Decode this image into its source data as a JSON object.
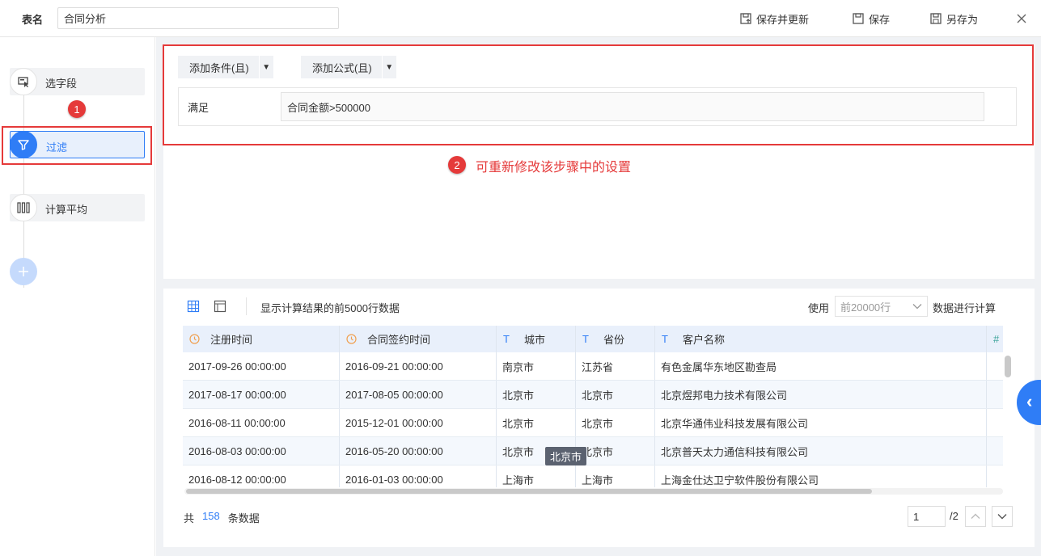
{
  "header": {
    "table_name_label": "表名",
    "table_name_value": "合同分析",
    "save_update_label": "保存并更新",
    "save_label": "保存",
    "save_as_label": "另存为"
  },
  "steps": [
    {
      "label": "选字段",
      "icon": "select-field-icon"
    },
    {
      "label": "过滤",
      "icon": "filter-icon"
    },
    {
      "label": "计算平均",
      "icon": "calc-average-icon"
    }
  ],
  "annotations": {
    "one": "1",
    "two": "2",
    "hint": "可重新修改该步骤中的设置",
    "color": "#e53a3a"
  },
  "filter": {
    "add_condition_label": "添加条件(且)",
    "add_formula_label": "添加公式(且)",
    "satisfy_label": "满足",
    "condition_value": "合同金额>500000"
  },
  "preview": {
    "info": "显示计算结果的前5000行数据",
    "use_label": "使用",
    "use_value": "前20000行",
    "use_suffix": "数据进行计算",
    "columns": [
      {
        "name": "注册时间",
        "type": "date"
      },
      {
        "name": "合同签约时间",
        "type": "date"
      },
      {
        "name": "城市",
        "type": "text"
      },
      {
        "name": "省份",
        "type": "text"
      },
      {
        "name": "客户名称",
        "type": "text"
      },
      {
        "name": "",
        "type": "number"
      }
    ],
    "rows": [
      [
        "2017-09-26 00:00:00",
        "2016-09-21 00:00:00",
        "南京市",
        "江苏省",
        "有色金属华东地区勘查局"
      ],
      [
        "2017-08-17 00:00:00",
        "2017-08-05 00:00:00",
        "北京市",
        "北京市",
        "北京煜邦电力技术有限公司"
      ],
      [
        "2016-08-11 00:00:00",
        "2015-12-01 00:00:00",
        "北京市",
        "北京市",
        "北京华通伟业科技发展有限公司"
      ],
      [
        "2016-08-03 00:00:00",
        "2016-05-20 00:00:00",
        "北京市",
        "北京市",
        "北京普天太力通信科技有限公司"
      ],
      [
        "2016-08-12 00:00:00",
        "2016-01-03 00:00:00",
        "上海市",
        "上海市",
        "上海金仕达卫宁软件股份有限公司"
      ]
    ],
    "tooltip": "北京市",
    "total_prefix": "共",
    "total_count": "158",
    "total_suffix": "条数据",
    "page_current": "1",
    "page_total": "/2"
  },
  "colors": {
    "accent": "#2f7df6",
    "annotation": "#e53a3a"
  }
}
